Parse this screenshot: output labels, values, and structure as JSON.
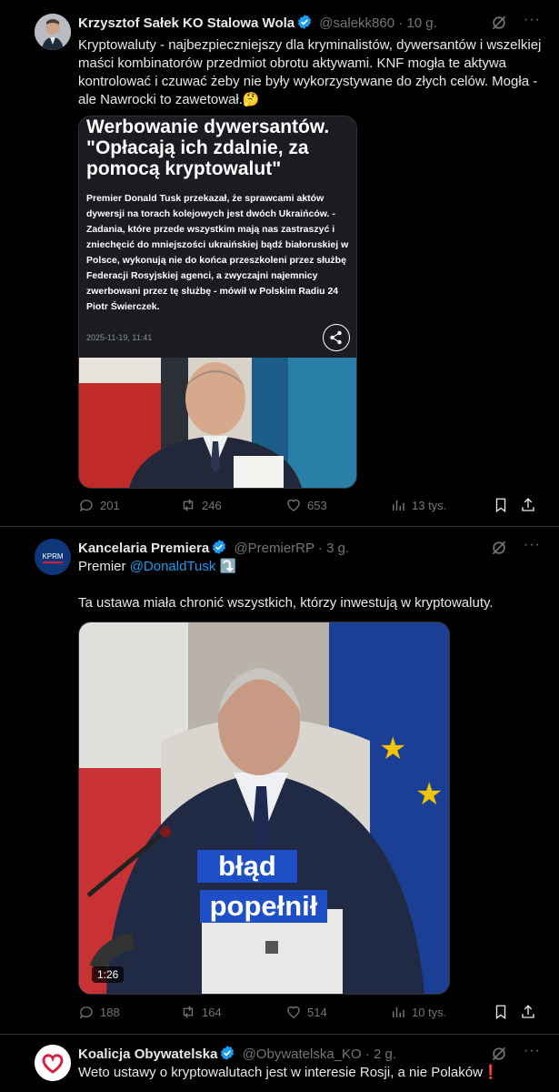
{
  "tweets": [
    {
      "author": "Krzysztof Sałek KO Stalowa Wola",
      "handle": "@salekk860",
      "separator": "·",
      "time": "10 g.",
      "text": "Kryptowaluty - najbezpieczniejszy dla kryminalistów, dywersantów i wszelkiej maści kombinatorów przedmiot obrotu aktywami. KNF mogła te aktywa kontrolować i czuwać żeby nie były wykorzystywane do złych celów. Mogła - ale Nawrocki to zawetował.🤔",
      "card": {
        "headline": "Werbowanie dywersantów. \"Opłacają ich zdalnie, za pomocą kryptowalut\"",
        "body": "Premier Donald Tusk przekazał, że sprawcami aktów dywersji na torach kolejowych jest dwóch Ukraińców. - Zadania, które przede wszystkim mają nas zastraszyć i zniechęcić do mniejszości ukraińskiej bądź białoruskiej w Polsce, wykonują nie do końca przeszkoleni przez służbę Federacji Rosyjskiej agenci, a zwyczajni najemnicy zwerbowani przez tę służbę - mówił w Polskim Radiu 24 Piotr Świerczek.",
        "date": "2025-11-19, 11:41"
      },
      "replies": "201",
      "reposts": "246",
      "likes": "653",
      "views": "13 tys."
    },
    {
      "author": "Kancelaria Premiera",
      "handle": "@PremierRP",
      "separator": "·",
      "time": "3 g.",
      "avatar_text": "KPRM",
      "text_prefix": "Premier ",
      "mention": "@DonaldTusk",
      "emoji": "⤵️",
      "text2": "Ta ustawa miała chronić wszystkich, którzy inwestują w kryptowaluty.",
      "subtitle_line1": "błąd",
      "subtitle_line2": "popełnił",
      "duration": "1:26",
      "replies": "188",
      "reposts": "164",
      "likes": "514",
      "views": "10 tys."
    },
    {
      "author": "Koalicja Obywatelska",
      "handle": "@Obywatelska_KO",
      "separator": "·",
      "time": "2 g.",
      "text": "Weto ustawy o kryptowalutach jest w interesie Rosji, a nie Polaków❗"
    }
  ],
  "colors": {
    "background": "#000000",
    "text": "#e7e9ea",
    "muted": "#71767b",
    "link": "#1d9bf0",
    "verified": "#1d9bf0"
  }
}
